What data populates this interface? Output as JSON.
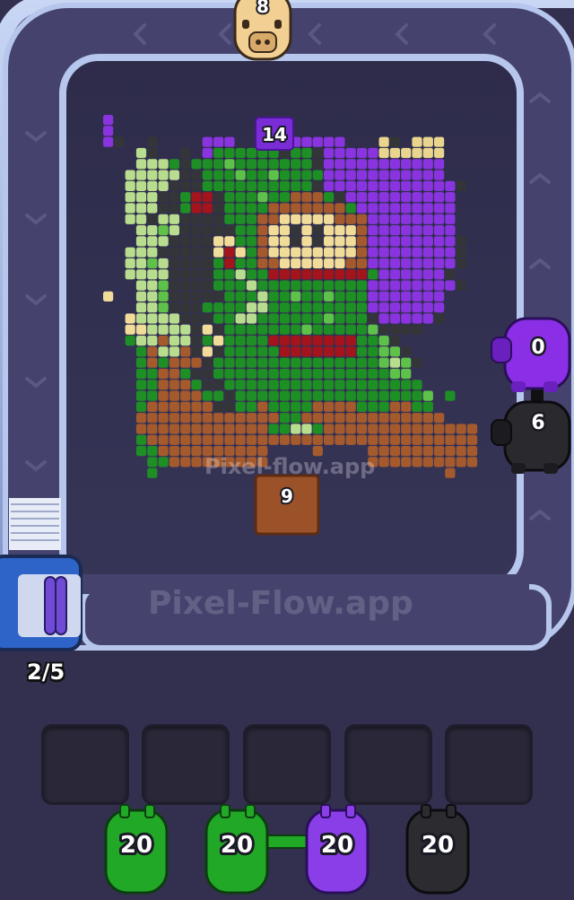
{
  "conveyor": {
    "top_pig_count": "8",
    "right_pig_1_count": "0",
    "right_pig_2_count": "6",
    "capacity": "2/5"
  },
  "board": {
    "purple_block_count": "14",
    "brown_block_count": "9"
  },
  "watermarks": {
    "board": "Pixel-flow.app",
    "track": "Pixel-Flow.app"
  },
  "queue": [
    {
      "count": "20",
      "color": "green",
      "hex": "#22a827"
    },
    {
      "count": "20",
      "color": "green",
      "hex": "#22a827"
    },
    {
      "count": "20",
      "color": "purple",
      "hex": "#8a3ee8"
    },
    {
      "count": "20",
      "color": "black",
      "hex": "#2b2b30"
    }
  ],
  "slots": [
    {
      "state": "empty"
    },
    {
      "state": "empty"
    },
    {
      "state": "empty"
    },
    {
      "state": "empty"
    },
    {
      "state": "empty"
    }
  ],
  "palette": {
    "G": "#1e8f25",
    "L": "#5ec24a",
    "P": "#b9dd8f",
    "K": "#343538",
    "B": "#a55a2e",
    "S": "#f2dc9a",
    "R": "#a3141c",
    "V": "#8a34e0",
    "Y": "#e9d58e"
  },
  "pixel_art_rows": [
    "V.....................................",
    "V.....................................",
    "VK..K....VVV.....VVVVV...YK.YYY.......",
    "...PK..K.VGGGGGGKGGKVVVVVYYYYYY.......",
    "...PPPGKGGGLGGGGGGGKVVVVVVVVVVV.......",
    "..PPPPPKKGGGLGGLGGGGVVVVVVVVVVV.......",
    "..PPPPKKKGGGGGGGGGGKVVVVVVVVVVVVK.....",
    "..PPPKKGRRKGGGLGGBBBGKVVVVVVVVVV......",
    "..PPPKKGRRKGGGGBBBBBBBGVVVVVVVVV......",
    "..PPKPPKKKKGGGBBSSSSSBBBVVVVVVVV......",
    "...PPLPKKKKKGGBSSKSKSSSBVVVVVVVV......",
    "...PPPKKKKSSGGBSSKSKSSSBVVVVVVVVK.....",
    "..PPPKKKKKSRSGBSSSSSSSSBVVVVVVVVK.....",
    "..PPLPKKKKGRGGBBSSSSSSBBVVVVVVVVK.....",
    "..PPPPKKKKGGPGGRRRRRRRRRGVVVVVVK......",
    "...PPLKKKKGGGPGGGGGGGGGGVVVVVVVVK.....",
    "S..PPLKKKKKGGGPGGLGGLGGGVVVVVVV.......",
    "...PPLKKKGGGGPPGGGGGGGGGVVVVVVV.......",
    "..SPPPPKKKGGPPGGGGGGLGGGKVVVVVK.......",
    "..SSPPPPKSKGGGGGGGLGGGGGLKKKK.........",
    "..GPPBPPKGSGGGGRRRRRRRRGGLK...........",
    "...GBPPBKSKGGGGGRRRRRRRGGLLK..........",
    "...GBGBBBKGGGGGGGGGGGGGGGLPLK.........",
    "...GGBBGKKGGGGGGGGGGGGGGGGLL..........",
    "...GGBBBGKKGGGGGGGGGGGGGGGGGG.........",
    "...GGBBBBGGKGGGGGGGGGGGGGGGGGL.G......",
    "...GBBBBBBKKGGBGGGGBBBBGGGBBGG........",
    "...BBBBBBBBBBBBBGGBBBBBBBBBBBBB.......",
    "...BBBBBBBBBBBBGGPPGBBBBBBBBBBBBBB....",
    "...GBBBBBBBBBBBBBBBBBBBBBBBBBBBBBB....",
    "...GGBBBBBBBBBB....B....BBBBBBBBBB....",
    "....GGBBBBBBBBB.........BBBBBBBBBB....",
    "....G..........................B......"
  ]
}
